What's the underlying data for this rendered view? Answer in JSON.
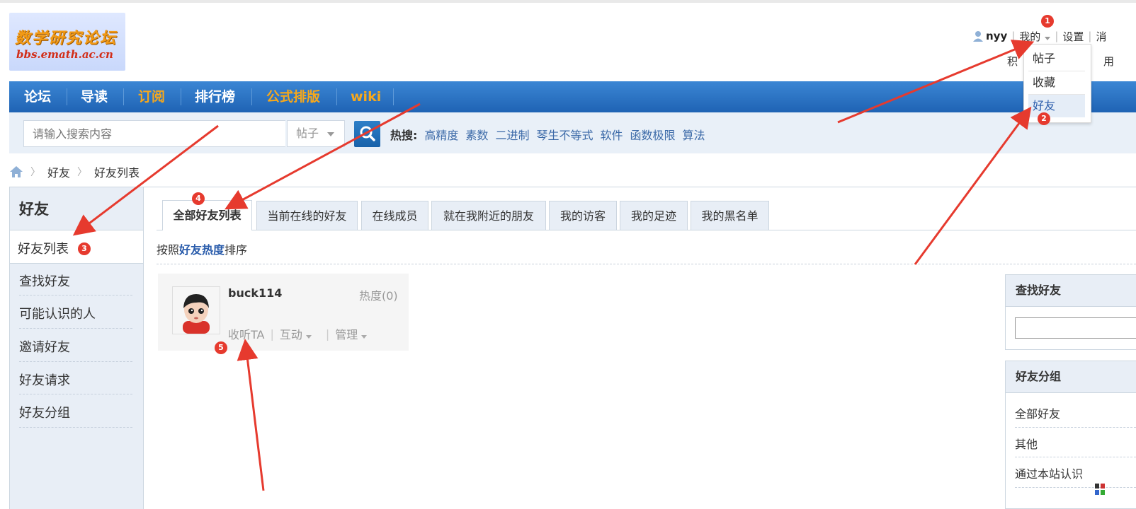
{
  "logo": {
    "line1": "数学研究论坛",
    "line2": "bbs.emath.ac.cn"
  },
  "userbar": {
    "username": "nyy",
    "my_label": "我的",
    "settings_label": "设置",
    "overflow_label": "消",
    "row2_left": "积",
    "row2_right": "用"
  },
  "my_menu": {
    "items": [
      {
        "label": "帖子"
      },
      {
        "label": "收藏"
      },
      {
        "label": "好友"
      }
    ]
  },
  "nav": {
    "items": [
      {
        "label": "论坛",
        "highlight": false
      },
      {
        "label": "导读",
        "highlight": false
      },
      {
        "label": "订阅",
        "highlight": true
      },
      {
        "label": "排行榜",
        "highlight": false
      },
      {
        "label": "公式排版",
        "highlight": true
      },
      {
        "label": "wiki",
        "highlight": true
      }
    ]
  },
  "search": {
    "placeholder": "请输入搜索内容",
    "type_label": "帖子",
    "hot_label": "热搜:",
    "hot_keywords": [
      "高精度",
      "素数",
      "二进制",
      "琴生不等式",
      "软件",
      "函数极限",
      "算法"
    ]
  },
  "breadcrumb": {
    "items": [
      "好友",
      "好友列表"
    ]
  },
  "sidebar": {
    "title": "好友",
    "items": [
      {
        "label": "好友列表",
        "active": true
      },
      {
        "label": "查找好友"
      },
      {
        "label": "可能认识的人"
      },
      {
        "label": "邀请好友"
      },
      {
        "label": "好友请求"
      },
      {
        "label": "好友分组"
      }
    ]
  },
  "tabs": [
    {
      "label": "全部好友列表",
      "active": true
    },
    {
      "label": "当前在线的好友"
    },
    {
      "label": "在线成员"
    },
    {
      "label": "就在我附近的朋友"
    },
    {
      "label": "我的访客"
    },
    {
      "label": "我的足迹"
    },
    {
      "label": "我的黑名单"
    }
  ],
  "sort": {
    "prefix": "按照",
    "key": "好友热度",
    "suffix": "排序"
  },
  "friend": {
    "name": "buck114",
    "heat": "热度(0)",
    "follow": "收听TA",
    "interact": "互动",
    "manage": "管理"
  },
  "right_panels": {
    "find_title": "查找好友",
    "group_title": "好友分组",
    "groups": [
      "全部好友",
      "其他",
      "通过本站认识"
    ]
  },
  "markers": [
    "1",
    "2",
    "3",
    "4",
    "5"
  ],
  "colors": {
    "nav_blue": "#1f63b4",
    "nav_highlight": "#f7a81b",
    "link": "#3c6aa8",
    "marker_red": "#e63a2e"
  }
}
